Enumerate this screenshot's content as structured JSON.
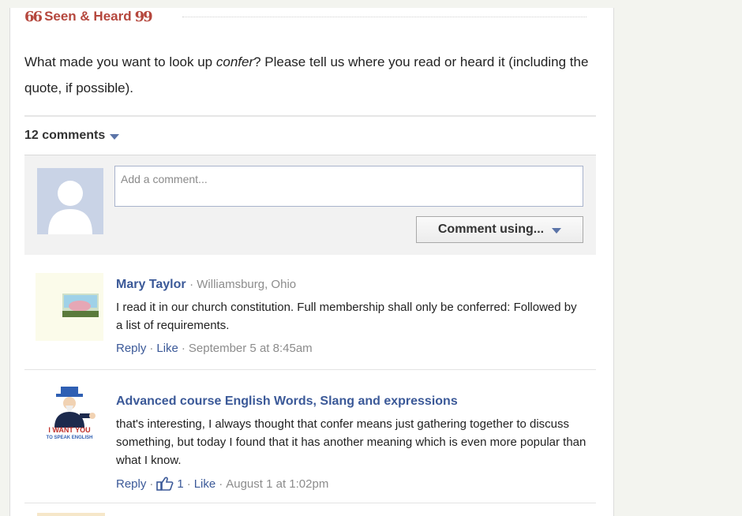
{
  "header": {
    "open_quote": "66",
    "title": "Seen & Heard",
    "close_quote": "99"
  },
  "prompt": {
    "before": "What made you want to look up ",
    "word": "confer",
    "after": "? Please tell us where you read or heard it (including the quote, if possible)."
  },
  "comments_bar": {
    "count_label": "12 comments"
  },
  "composer": {
    "placeholder": "Add a comment...",
    "using_label": "Comment using..."
  },
  "comments": [
    {
      "author": "Mary Taylor",
      "location": "Williamsburg, Ohio",
      "text": "I read it in our church constitution. Full membership shall only be conferred: Followed by a list of requirements.",
      "reply": "Reply",
      "like": "Like",
      "likes": "",
      "time": "September 5 at 8:45am"
    },
    {
      "author": "Advanced course English Words, Slang and expressions",
      "location": "",
      "text": "that's interesting, I always thought that confer means just gathering together to discuss something, but today I found that it has another meaning which is even more popular than what I know.",
      "reply": "Reply",
      "like": "Like",
      "likes": "1",
      "time": "August 1 at 1:02pm",
      "avatar_text_top": "I WANT YOU",
      "avatar_text_bottom": "TO SPEAK ENGLISH"
    }
  ],
  "colors": {
    "brand_red": "#b5473d",
    "link_blue": "#3b5998",
    "meta_gray": "#8c8c8c"
  },
  "icons": [
    "default-avatar-icon",
    "chevron-down-icon",
    "thumbs-up-icon"
  ]
}
